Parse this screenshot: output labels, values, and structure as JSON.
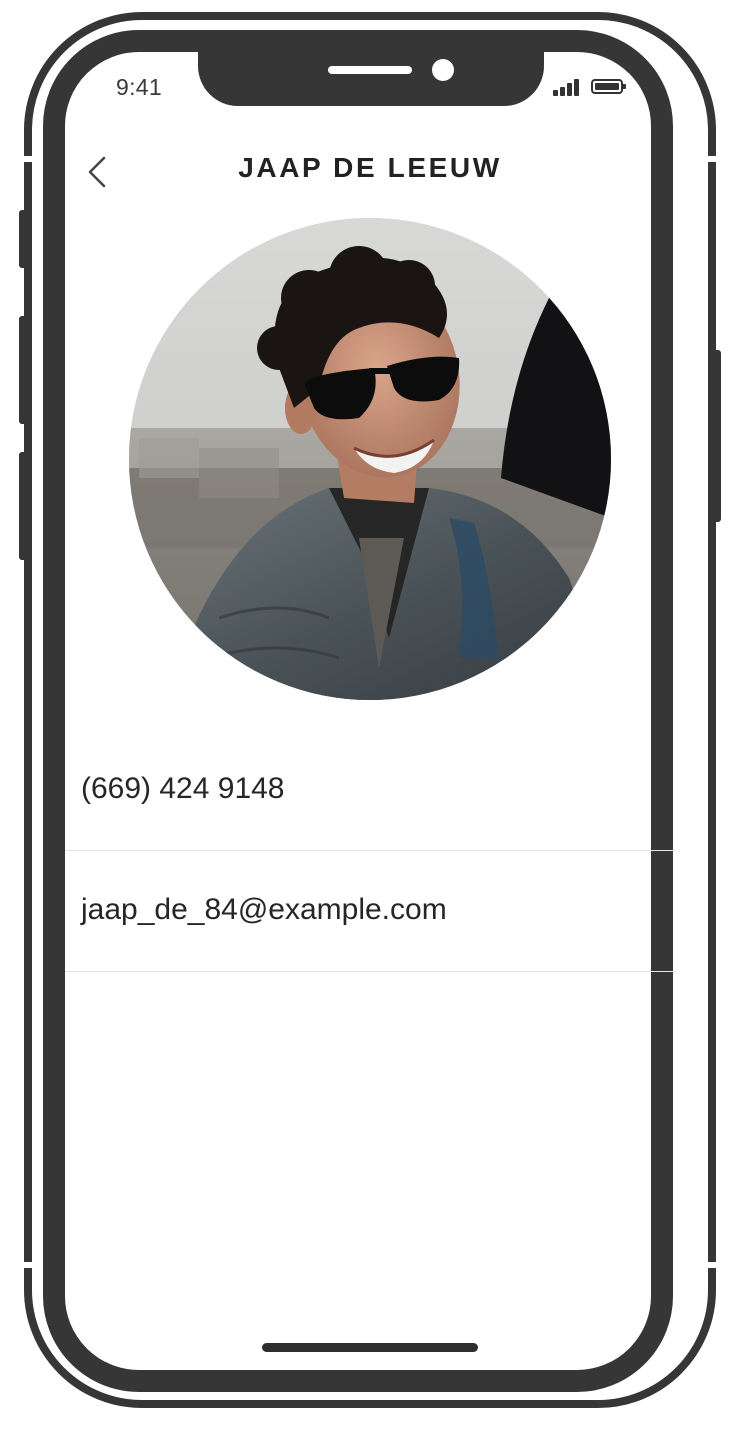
{
  "status_bar": {
    "time": "9:41"
  },
  "header": {
    "title": "JAAP DE LEEUW",
    "back_icon": "chevron-left-icon"
  },
  "contact": {
    "avatar_description": "profile photo of contact",
    "phone": "(669) 424 9148",
    "email": "jaap_de_84@example.com"
  },
  "colors": {
    "frame": "#363636",
    "text": "#262626",
    "divider": "#e4e4e4"
  }
}
